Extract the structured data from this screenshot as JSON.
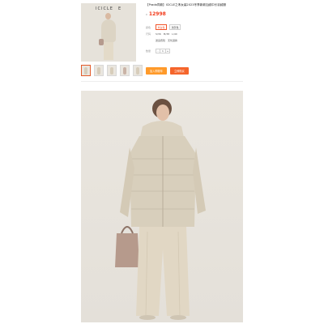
{
  "product": {
    "title": "【Prada同款】ICICLE之禾女装2023冬季新款加绒中长羽绒服",
    "price_label": "¥",
    "price": "12998",
    "brand_logo_text": "ICICLE",
    "brand_mark": "E"
  },
  "options": {
    "row1_label": "颜色",
    "row1_chips": [
      "米白色",
      "浅灰色"
    ],
    "row2_label": "尺码",
    "row2_text": [
      "S/36",
      "M/38",
      "L/40"
    ],
    "row3_label": "",
    "row3_text": [
      "送运费险",
      "无忧退换"
    ],
    "row4_label": "数量",
    "stepper": {
      "minus": "-",
      "qty": "1",
      "plus": "+"
    }
  },
  "buttons": {
    "cart": "加入购物车",
    "buy": "立即购买"
  },
  "colors": {
    "accent": "#f5652b",
    "price": "#f23a1a",
    "cart": "#ff9a2a"
  }
}
